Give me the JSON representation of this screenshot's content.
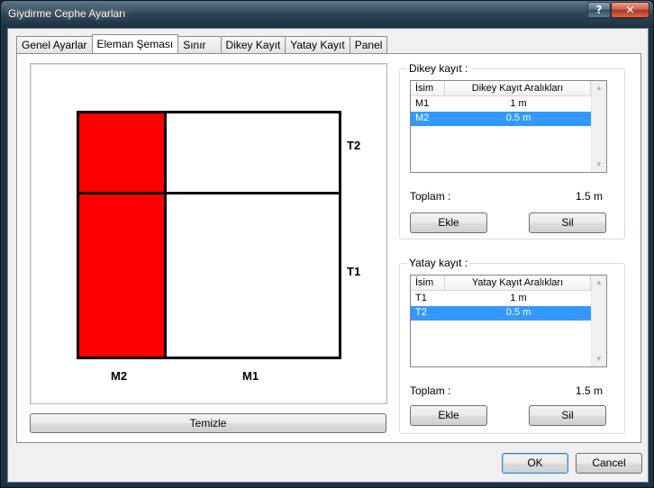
{
  "window": {
    "title": "Giydirme Cephe Ayarları",
    "help_glyph": "?",
    "close_glyph": "✕"
  },
  "tabs": [
    {
      "label": "Genel Ayarlar"
    },
    {
      "label": "Eleman Şeması"
    },
    {
      "label": "Sınır"
    },
    {
      "label": "Dikey Kayıt"
    },
    {
      "label": "Yatay Kayıt"
    },
    {
      "label": "Panel"
    }
  ],
  "active_tab": "Eleman Şeması",
  "schema": {
    "row_labels": {
      "top": "T2",
      "bottom": "T1"
    },
    "col_labels": {
      "left": "M2",
      "right": "M1"
    },
    "selected_color": "#ff0000",
    "clear_button": "Temizle"
  },
  "vertical_group": {
    "title": "Dikey kayıt :",
    "columns": [
      "İsim",
      "Dikey Kayıt Aralıkları"
    ],
    "rows": [
      {
        "name": "M1",
        "value": "1 m",
        "selected": false
      },
      {
        "name": "M2",
        "value": "0.5 m",
        "selected": true
      }
    ],
    "total_label": "Toplam :",
    "total_value": "1.5 m",
    "add_button": "Ekle",
    "delete_button": "Sil"
  },
  "horizontal_group": {
    "title": "Yatay kayıt :",
    "columns": [
      "İsim",
      "Yatay Kayıt Aralıkları"
    ],
    "rows": [
      {
        "name": "T1",
        "value": "1 m",
        "selected": false
      },
      {
        "name": "T2",
        "value": "0.5 m",
        "selected": true
      }
    ],
    "total_label": "Toplam :",
    "total_value": "1.5 m",
    "add_button": "Ekle",
    "delete_button": "Sil"
  },
  "footer": {
    "ok_button": "OK",
    "cancel_button": "Cancel"
  },
  "colors": {
    "selection": "#3399ff",
    "panel_selected": "#ff0000"
  }
}
